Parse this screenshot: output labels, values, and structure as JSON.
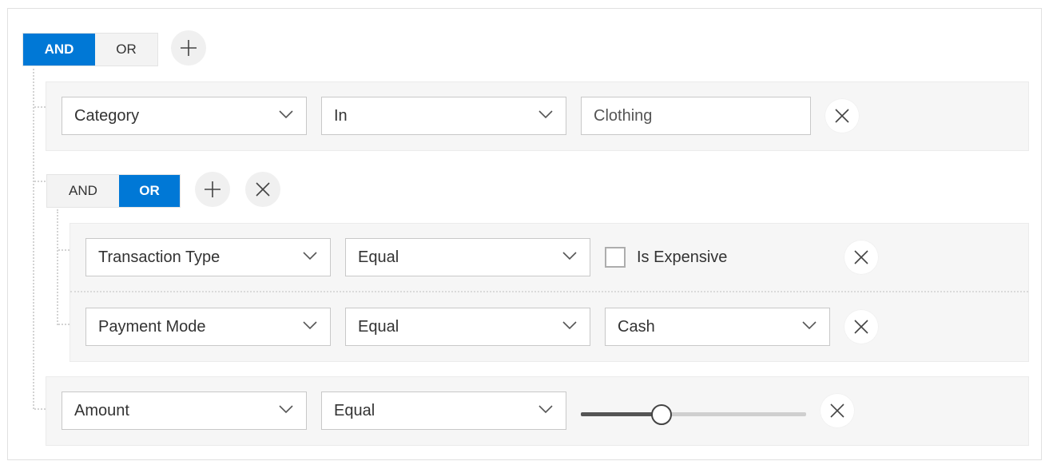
{
  "root_group": {
    "condition_labels": {
      "and": "AND",
      "or": "OR"
    },
    "active_condition": "and",
    "rules": [
      {
        "field": "Category",
        "operator": "In",
        "value": "Clothing"
      }
    ]
  },
  "nested_group": {
    "condition_labels": {
      "and": "AND",
      "or": "OR"
    },
    "active_condition": "or",
    "rules": [
      {
        "field": "Transaction Type",
        "operator": "Equal",
        "checkbox_label": "Is Expensive",
        "checked": false
      },
      {
        "field": "Payment Mode",
        "operator": "Equal",
        "value": "Cash"
      }
    ]
  },
  "last_rule": {
    "field": "Amount",
    "operator": "Equal",
    "slider_fraction": 0.35
  },
  "icons": {
    "add": "plus-icon",
    "remove": "close-icon",
    "dropdown": "chevron-down-icon"
  },
  "colors": {
    "accent": "#0078d6",
    "rule_background": "#f6f6f6",
    "toggle_inactive": "#f3f3f3"
  }
}
